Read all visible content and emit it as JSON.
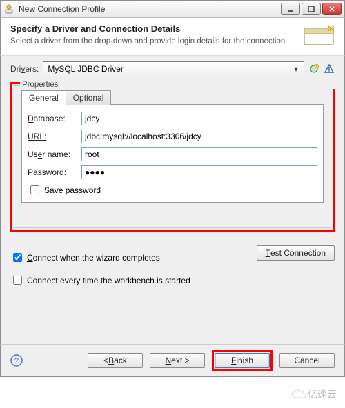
{
  "window": {
    "title": "New Connection Profile"
  },
  "header": {
    "title": "Specify a Driver and Connection Details",
    "subtitle": "Select a driver from the drop-down and provide login details for the connection."
  },
  "drivers": {
    "label_pre": "Dri",
    "label_u": "v",
    "label_post": "ers:",
    "selected": "MySQL JDBC Driver"
  },
  "properties": {
    "legend": "Properties",
    "tabs": {
      "general": "General",
      "optional": "Optional"
    },
    "fields": {
      "database_label_u": "D",
      "database_label_post": "atabase:",
      "database_value": "jdcy",
      "url_label": "URL:",
      "url_value": "jdbc:mysql://localhost:3306/jdcy",
      "username_label_pre": "Us",
      "username_label_u": "e",
      "username_label_post": "r name:",
      "username_value": "root",
      "password_label_u": "P",
      "password_label_post": "assword:",
      "password_value": "●●●●",
      "save_label_u": "S",
      "save_label_post": "ave password"
    }
  },
  "options": {
    "connect_complete_u": "C",
    "connect_complete_post": "onnect when the wizard completes",
    "connect_startup": "Connect every time the workbench is started",
    "test_label_u": "T",
    "test_label_post": "est Connection"
  },
  "buttons": {
    "back_pre": "< ",
    "back_u": "B",
    "back_post": "ack",
    "next_u": "N",
    "next_post": "ext >",
    "finish_u": "F",
    "finish_post": "inish",
    "cancel": "Cancel"
  },
  "watermark": "亿速云"
}
